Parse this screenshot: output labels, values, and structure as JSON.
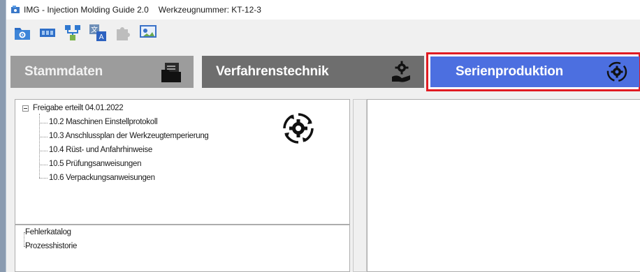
{
  "window": {
    "app_title": "IMG - Injection Molding Guide 2.0",
    "tool_number": "Werkzeugnummer: KT-12-3"
  },
  "toolbar": {
    "buttons": [
      {
        "icon": "folder-settings-icon"
      },
      {
        "icon": "mold-icon"
      },
      {
        "icon": "network-icon"
      },
      {
        "icon": "translate-icon"
      },
      {
        "icon": "puzzle-icon"
      },
      {
        "icon": "presentation-icon"
      }
    ]
  },
  "modules": {
    "stammdaten": {
      "label": "Stammdaten",
      "icon": "folder-document-icon"
    },
    "verfahrenstechnik": {
      "label": "Verfahrenstechnik",
      "icon": "gear-hand-icon"
    },
    "serienproduktion": {
      "label": "Serienproduktion",
      "icon": "gear-cycle-icon",
      "selected": true
    }
  },
  "tree_main": {
    "root": "Freigabe erteilt 04.01.2022",
    "items": [
      "10.2 Maschinen Einstellprotokoll",
      "10.3 Anschlussplan der Werkzeugtemperierung",
      "10.4 Rüst- und Anfahrhinweise",
      "10.5 Prüfungsanweisungen",
      "10.6 Verpackungsanweisungen"
    ]
  },
  "tree_secondary": {
    "items": [
      "Fehlerkatalog",
      "Prozesshistorie"
    ]
  },
  "colors": {
    "selected_module": "#4c6fe0",
    "selected_outline": "#e01b22",
    "stammdaten_bg": "#9c9c9c",
    "verfahren_bg": "#6e6e6e"
  }
}
